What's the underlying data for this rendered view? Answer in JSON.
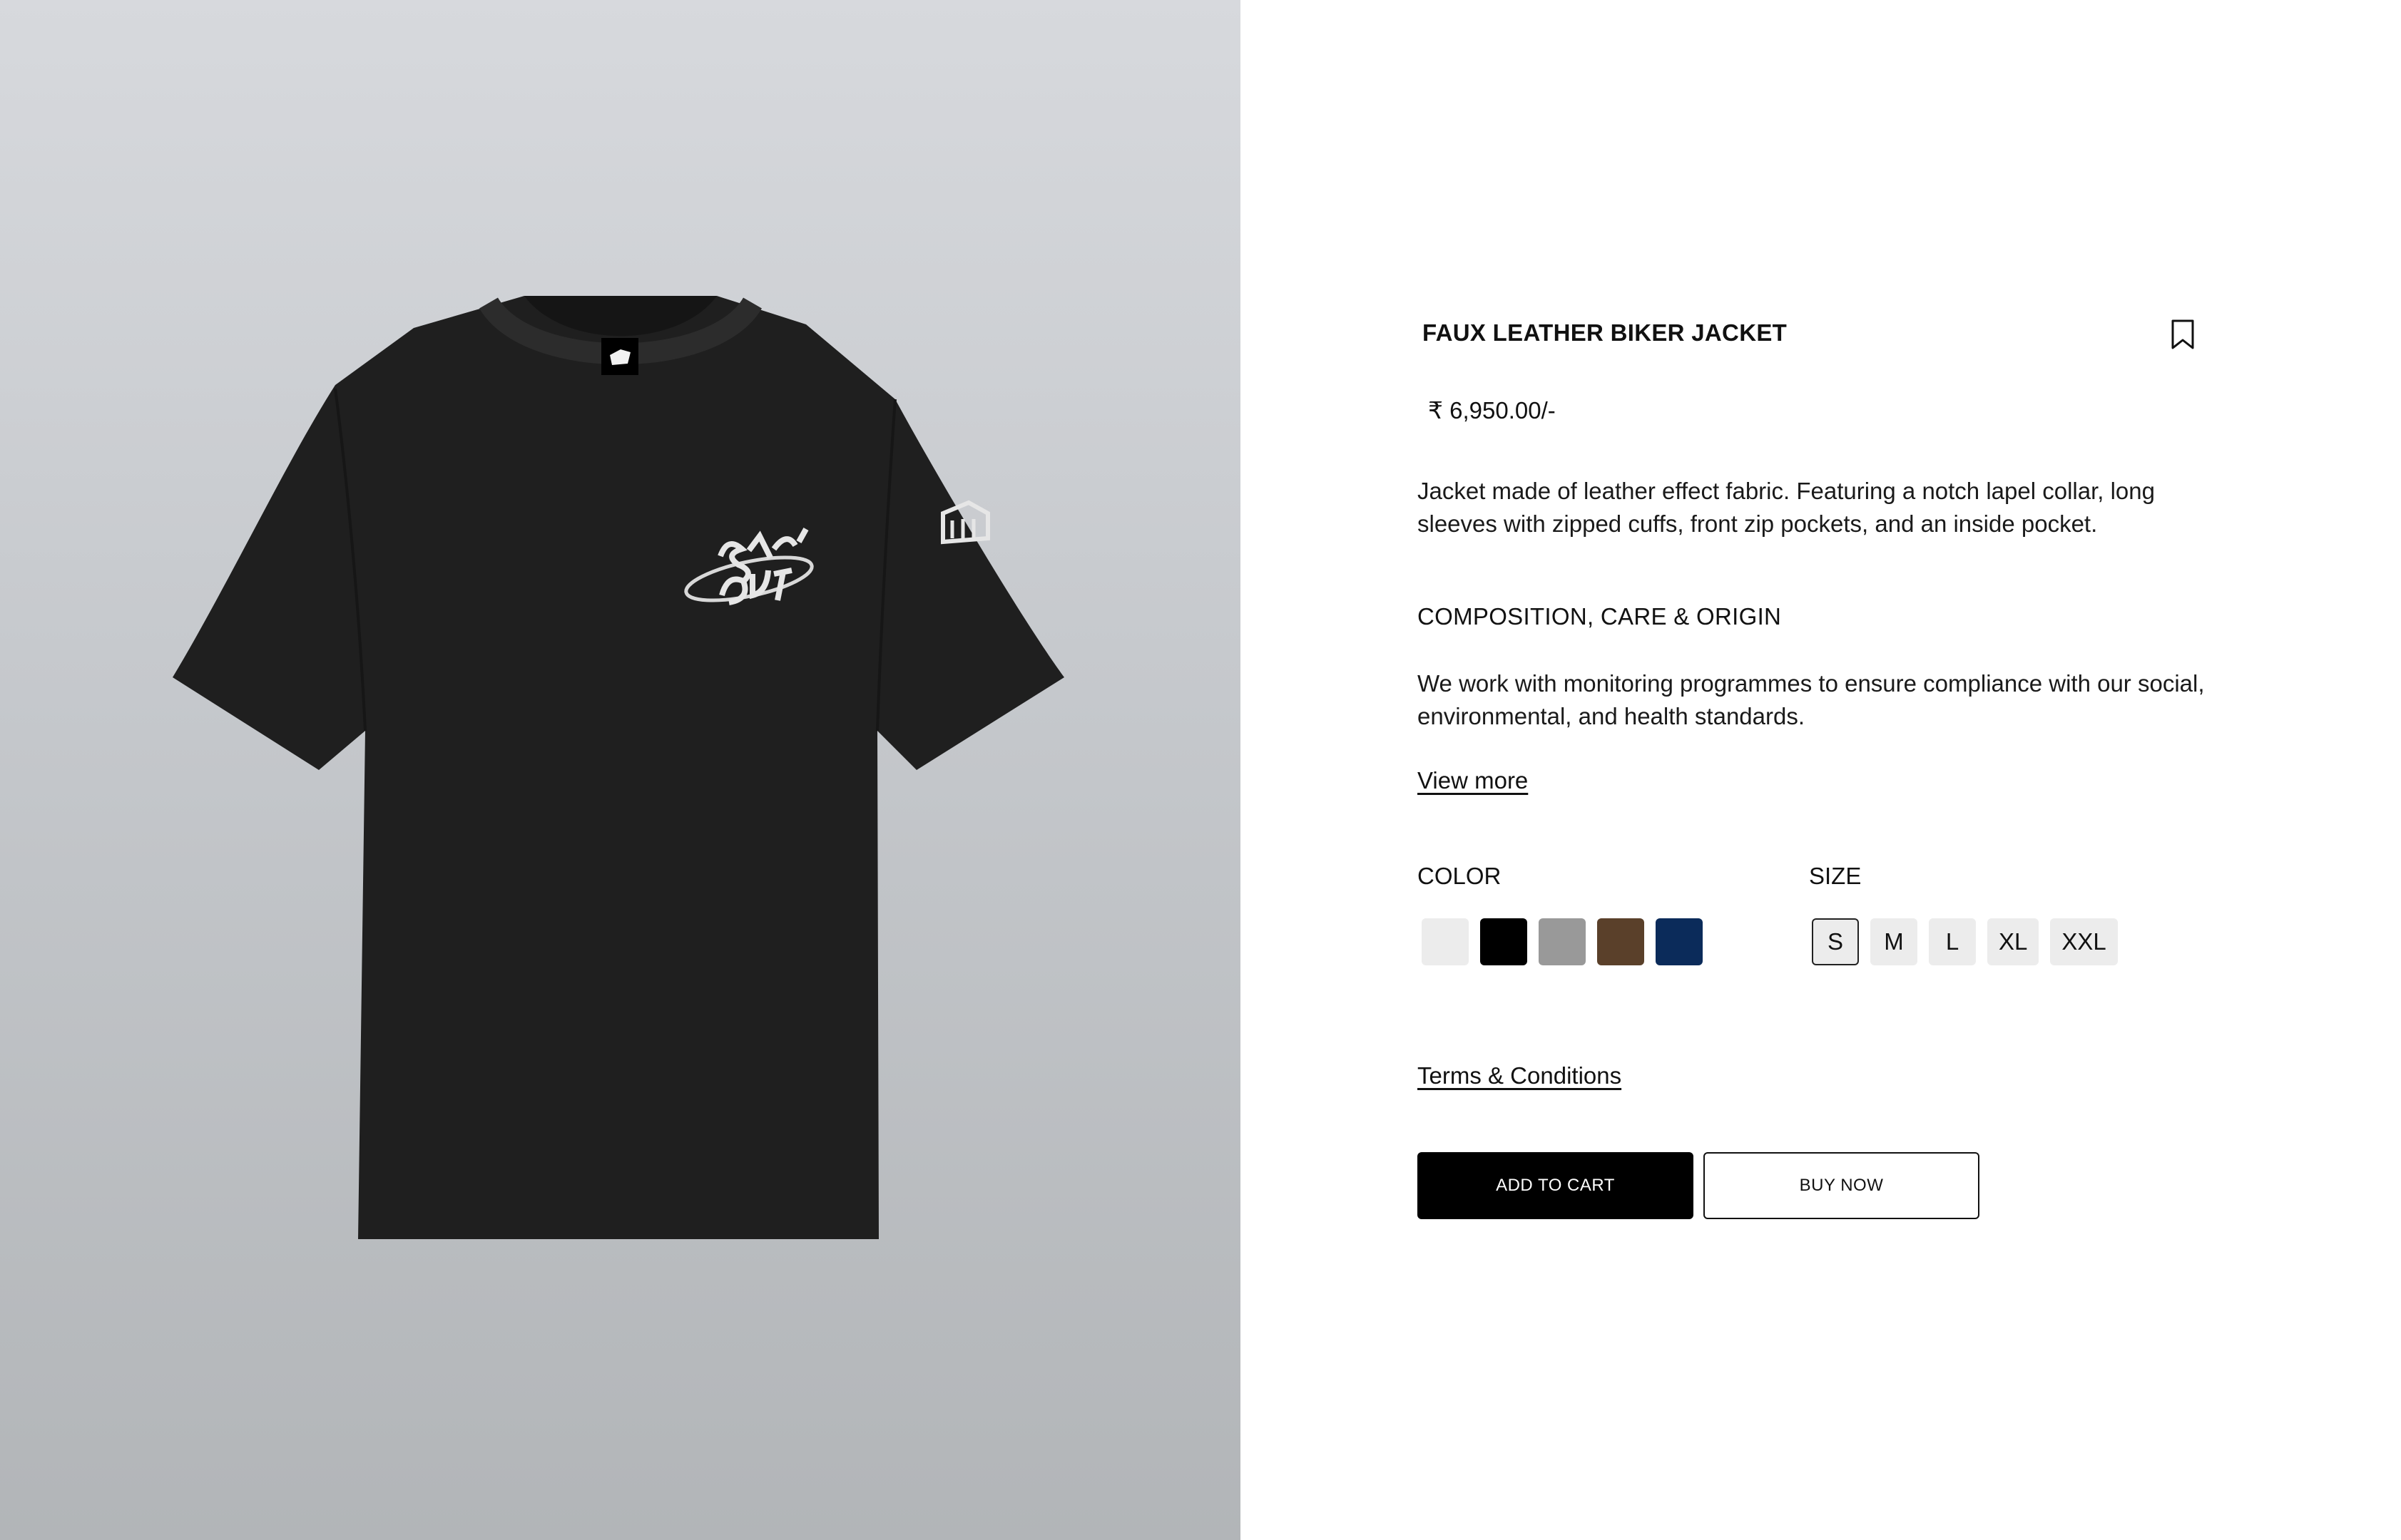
{
  "product": {
    "title": "FAUX LEATHER BIKER JACKET",
    "price": "₹ 6,950.00/-",
    "description": "Jacket made of leather effect fabric. Featuring a notch lapel collar, long sleeves with zipped cuffs, front zip pockets, and an inside pocket.",
    "image_icon": "tshirt-image"
  },
  "bookmark": {
    "icon": "bookmark-icon"
  },
  "composition": {
    "heading": "COMPOSITION, CARE & ORIGIN",
    "text": "We work with monitoring programmes to ensure compliance with our social, environmental, and health standards.",
    "view_more_label": "View more"
  },
  "color": {
    "label": "COLOR",
    "options": [
      {
        "name": "white",
        "hex": "#ececec"
      },
      {
        "name": "black",
        "hex": "#000000"
      },
      {
        "name": "grey",
        "hex": "#999999"
      },
      {
        "name": "brown",
        "hex": "#5a402a"
      },
      {
        "name": "navy",
        "hex": "#0b2b5a"
      }
    ]
  },
  "size": {
    "label": "SIZE",
    "options": [
      "S",
      "M",
      "L",
      "XL",
      "XXL"
    ],
    "selected": "S"
  },
  "terms_label": "Terms & Conditions",
  "actions": {
    "add_to_cart_label": "ADD TO CART",
    "buy_now_label": "BUY NOW"
  },
  "colors": {
    "primary": "#000000",
    "background": "#ffffff",
    "image_bg_top": "#d7d9dd",
    "image_bg_bottom": "#b2b5b8"
  }
}
